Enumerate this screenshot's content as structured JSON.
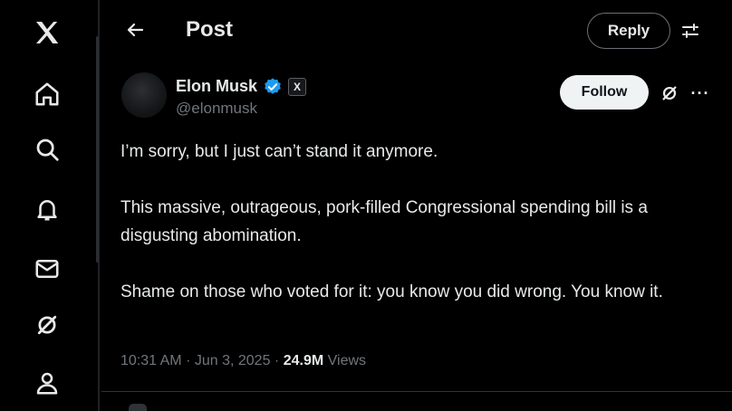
{
  "sidebar": {
    "items": [
      {
        "name": "x-logo-icon"
      },
      {
        "name": "home-icon"
      },
      {
        "name": "search-icon"
      },
      {
        "name": "notifications-icon"
      },
      {
        "name": "messages-icon"
      },
      {
        "name": "grok-icon"
      },
      {
        "name": "profile-icon"
      }
    ]
  },
  "header": {
    "title": "Post",
    "reply_label": "Reply"
  },
  "post": {
    "author_name": "Elon Musk",
    "author_handle": "@elonmusk",
    "affiliate_badge": "X",
    "follow_label": "Follow",
    "more_label": "···",
    "paragraphs": [
      "I’m sorry, but I just can’t stand it anymore.",
      "This massive, outrageous, pork-filled Congressional spending bill is a disgusting abomination.",
      "Shame on those who voted for it: you know you did wrong. You know it."
    ],
    "time": "10:31 AM",
    "date": "Jun 3, 2025",
    "views_count": "24.9M",
    "views_label": "Views"
  },
  "colors": {
    "background": "#000000",
    "text": "#e7e9ea",
    "muted": "#71767b",
    "verified": "#1d9bf0",
    "follow_bg": "#eff3f4"
  }
}
